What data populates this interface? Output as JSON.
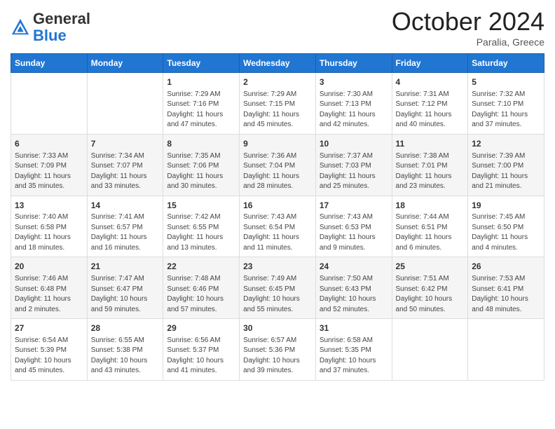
{
  "header": {
    "logo_general": "General",
    "logo_blue": "Blue",
    "month_title": "October 2024",
    "location": "Paralia, Greece"
  },
  "weekdays": [
    "Sunday",
    "Monday",
    "Tuesday",
    "Wednesday",
    "Thursday",
    "Friday",
    "Saturday"
  ],
  "weeks": [
    [
      {
        "day": "",
        "info": ""
      },
      {
        "day": "",
        "info": ""
      },
      {
        "day": "1",
        "info": "Sunrise: 7:29 AM\nSunset: 7:16 PM\nDaylight: 11 hours and 47 minutes."
      },
      {
        "day": "2",
        "info": "Sunrise: 7:29 AM\nSunset: 7:15 PM\nDaylight: 11 hours and 45 minutes."
      },
      {
        "day": "3",
        "info": "Sunrise: 7:30 AM\nSunset: 7:13 PM\nDaylight: 11 hours and 42 minutes."
      },
      {
        "day": "4",
        "info": "Sunrise: 7:31 AM\nSunset: 7:12 PM\nDaylight: 11 hours and 40 minutes."
      },
      {
        "day": "5",
        "info": "Sunrise: 7:32 AM\nSunset: 7:10 PM\nDaylight: 11 hours and 37 minutes."
      }
    ],
    [
      {
        "day": "6",
        "info": "Sunrise: 7:33 AM\nSunset: 7:09 PM\nDaylight: 11 hours and 35 minutes."
      },
      {
        "day": "7",
        "info": "Sunrise: 7:34 AM\nSunset: 7:07 PM\nDaylight: 11 hours and 33 minutes."
      },
      {
        "day": "8",
        "info": "Sunrise: 7:35 AM\nSunset: 7:06 PM\nDaylight: 11 hours and 30 minutes."
      },
      {
        "day": "9",
        "info": "Sunrise: 7:36 AM\nSunset: 7:04 PM\nDaylight: 11 hours and 28 minutes."
      },
      {
        "day": "10",
        "info": "Sunrise: 7:37 AM\nSunset: 7:03 PM\nDaylight: 11 hours and 25 minutes."
      },
      {
        "day": "11",
        "info": "Sunrise: 7:38 AM\nSunset: 7:01 PM\nDaylight: 11 hours and 23 minutes."
      },
      {
        "day": "12",
        "info": "Sunrise: 7:39 AM\nSunset: 7:00 PM\nDaylight: 11 hours and 21 minutes."
      }
    ],
    [
      {
        "day": "13",
        "info": "Sunrise: 7:40 AM\nSunset: 6:58 PM\nDaylight: 11 hours and 18 minutes."
      },
      {
        "day": "14",
        "info": "Sunrise: 7:41 AM\nSunset: 6:57 PM\nDaylight: 11 hours and 16 minutes."
      },
      {
        "day": "15",
        "info": "Sunrise: 7:42 AM\nSunset: 6:55 PM\nDaylight: 11 hours and 13 minutes."
      },
      {
        "day": "16",
        "info": "Sunrise: 7:43 AM\nSunset: 6:54 PM\nDaylight: 11 hours and 11 minutes."
      },
      {
        "day": "17",
        "info": "Sunrise: 7:43 AM\nSunset: 6:53 PM\nDaylight: 11 hours and 9 minutes."
      },
      {
        "day": "18",
        "info": "Sunrise: 7:44 AM\nSunset: 6:51 PM\nDaylight: 11 hours and 6 minutes."
      },
      {
        "day": "19",
        "info": "Sunrise: 7:45 AM\nSunset: 6:50 PM\nDaylight: 11 hours and 4 minutes."
      }
    ],
    [
      {
        "day": "20",
        "info": "Sunrise: 7:46 AM\nSunset: 6:48 PM\nDaylight: 11 hours and 2 minutes."
      },
      {
        "day": "21",
        "info": "Sunrise: 7:47 AM\nSunset: 6:47 PM\nDaylight: 10 hours and 59 minutes."
      },
      {
        "day": "22",
        "info": "Sunrise: 7:48 AM\nSunset: 6:46 PM\nDaylight: 10 hours and 57 minutes."
      },
      {
        "day": "23",
        "info": "Sunrise: 7:49 AM\nSunset: 6:45 PM\nDaylight: 10 hours and 55 minutes."
      },
      {
        "day": "24",
        "info": "Sunrise: 7:50 AM\nSunset: 6:43 PM\nDaylight: 10 hours and 52 minutes."
      },
      {
        "day": "25",
        "info": "Sunrise: 7:51 AM\nSunset: 6:42 PM\nDaylight: 10 hours and 50 minutes."
      },
      {
        "day": "26",
        "info": "Sunrise: 7:53 AM\nSunset: 6:41 PM\nDaylight: 10 hours and 48 minutes."
      }
    ],
    [
      {
        "day": "27",
        "info": "Sunrise: 6:54 AM\nSunset: 5:39 PM\nDaylight: 10 hours and 45 minutes."
      },
      {
        "day": "28",
        "info": "Sunrise: 6:55 AM\nSunset: 5:38 PM\nDaylight: 10 hours and 43 minutes."
      },
      {
        "day": "29",
        "info": "Sunrise: 6:56 AM\nSunset: 5:37 PM\nDaylight: 10 hours and 41 minutes."
      },
      {
        "day": "30",
        "info": "Sunrise: 6:57 AM\nSunset: 5:36 PM\nDaylight: 10 hours and 39 minutes."
      },
      {
        "day": "31",
        "info": "Sunrise: 6:58 AM\nSunset: 5:35 PM\nDaylight: 10 hours and 37 minutes."
      },
      {
        "day": "",
        "info": ""
      },
      {
        "day": "",
        "info": ""
      }
    ]
  ]
}
